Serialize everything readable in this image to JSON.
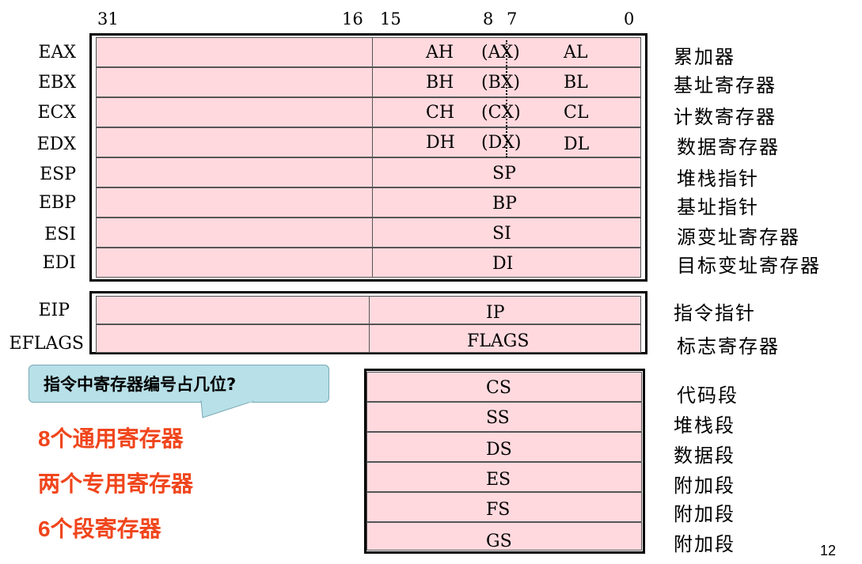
{
  "bits": {
    "b31": "31",
    "b16": "16",
    "b15": "15",
    "b8": "8",
    "b7": "7",
    "b0": "0"
  },
  "general": [
    {
      "name": "EAX",
      "hi": "AH",
      "mid": "(AX)",
      "lo": "AL",
      "desc": "累加器"
    },
    {
      "name": "EBX",
      "hi": "BH",
      "mid": "(BX)",
      "lo": "BL",
      "desc": "基址寄存器"
    },
    {
      "name": "ECX",
      "hi": "CH",
      "mid": "(CX)",
      "lo": "CL",
      "desc": "计数寄存器"
    },
    {
      "name": "EDX",
      "hi": "DH",
      "mid": "(DX)",
      "lo": "DL",
      "desc": "数据寄存器"
    },
    {
      "name": "ESP",
      "low": "SP",
      "desc": "堆栈指针"
    },
    {
      "name": "EBP",
      "low": "BP",
      "desc": "基址指针"
    },
    {
      "name": "ESI",
      "low": "SI",
      "desc": "源变址寄存器"
    },
    {
      "name": "EDI",
      "low": "DI",
      "desc": "目标变址寄存器"
    }
  ],
  "special": [
    {
      "name": "EIP",
      "low": "IP",
      "desc": "指令指针"
    },
    {
      "name": "EFLAGS",
      "low": "FLAGS",
      "desc": "标志寄存器"
    }
  ],
  "segments": [
    {
      "name": "CS",
      "desc": "代码段"
    },
    {
      "name": "SS",
      "desc": "堆栈段"
    },
    {
      "name": "DS",
      "desc": "数据段"
    },
    {
      "name": "ES",
      "desc": "附加段"
    },
    {
      "name": "FS",
      "desc": "附加段"
    },
    {
      "name": "GS",
      "desc": "附加段"
    }
  ],
  "callout": "指令中寄存器编号占几位?",
  "notes": [
    "8个通用寄存器",
    "两个专用寄存器",
    "6个段寄存器"
  ],
  "page_number": "12",
  "colors": {
    "register_fill": "#ffd9de",
    "callout_fill": "#b7e0e8",
    "note_color": "#f0451c"
  }
}
